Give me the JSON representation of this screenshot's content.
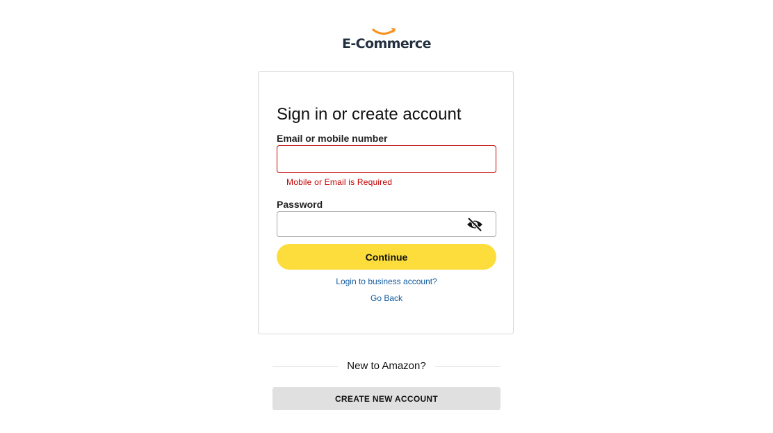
{
  "brand": {
    "logo_text": "E-Commerce",
    "smile_color": "#f7931e",
    "text_color": "#232f3e"
  },
  "signin": {
    "title": "Sign in or create account",
    "email_label": "Email or mobile number",
    "email_value": "",
    "email_error": "Mobile or Email is Required",
    "password_label": "Password",
    "password_value": "",
    "password_toggle_icon": "eye-off-icon",
    "continue_label": "Continue",
    "business_link": "Login to business account?",
    "back_link": "Go Back"
  },
  "signup": {
    "divider_text": "New to Amazon?",
    "create_label": "CREATE NEW ACCOUNT"
  },
  "colors": {
    "continue_bg": "#fcdd3c",
    "error": "#c40000",
    "link": "#0f5a9c",
    "create_bg": "#e0e0e0"
  }
}
